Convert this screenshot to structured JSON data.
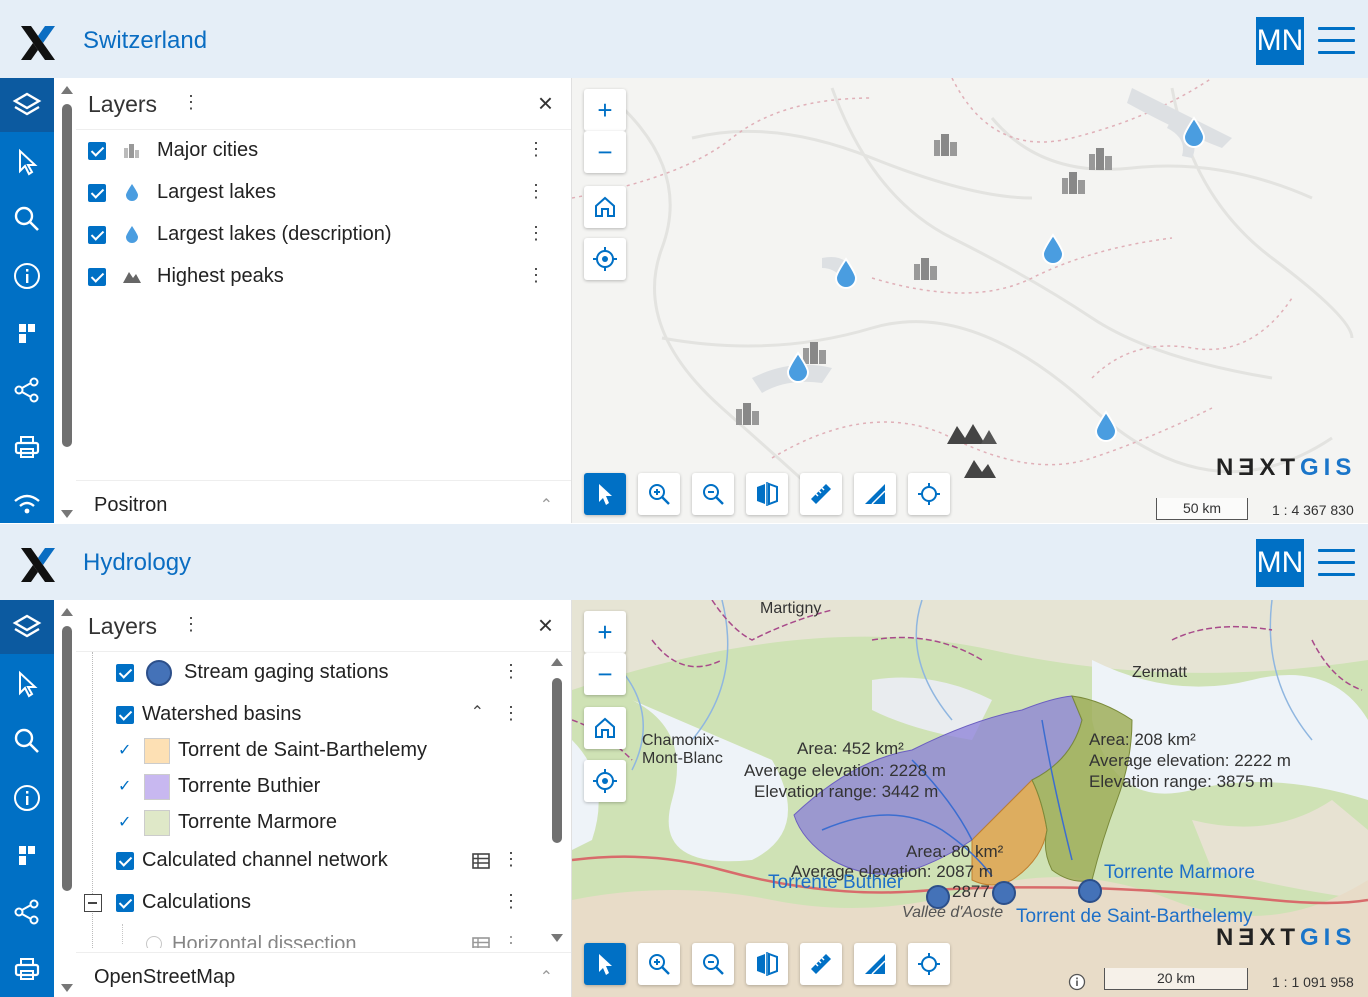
{
  "colors": {
    "primary": "#0070c5",
    "header_bg": "#e5eef7",
    "title": "#0a6dc2"
  },
  "top_panel": {
    "title": "Switzerland",
    "user_initials": "MN",
    "layers": {
      "heading": "Layers",
      "items": [
        {
          "label": "Major cities",
          "icon": "city-icon",
          "checked": true
        },
        {
          "label": "Largest lakes",
          "icon": "water-drop-icon",
          "checked": true
        },
        {
          "label": "Largest lakes (description)",
          "icon": "water-drop-icon",
          "checked": true
        },
        {
          "label": "Highest peaks",
          "icon": "mountain-icon",
          "checked": true
        }
      ],
      "basemap": "Positron"
    },
    "map": {
      "scale_label": "50 km",
      "scale_ratio": "1 : 4 367 830",
      "brand_a": "NƎXT",
      "brand_b": "GIS"
    }
  },
  "bottom_panel": {
    "title": "Hydrology",
    "user_initials": "MN",
    "layers": {
      "heading": "Layers",
      "items": [
        {
          "label": "Stream gaging stations"
        },
        {
          "label": "Watershed basins"
        },
        {
          "label": "Torrent de Saint-Barthelemy",
          "color": "#fde0b4"
        },
        {
          "label": "Torrente Buthier",
          "color": "#c8b8f0"
        },
        {
          "label": "Torrente Marmore",
          "color": "#dfe8c8"
        },
        {
          "label": "Calculated channel network"
        },
        {
          "label": "Calculations"
        },
        {
          "label": "Horizontal dissection"
        }
      ],
      "basemap": "OpenStreetMap"
    },
    "map": {
      "places": [
        "Martigny",
        "Zermatt",
        "Chamonix-",
        "Mont-Blanc",
        "Vallée d'Aoste"
      ],
      "basin_a": [
        "Area: 452 km²",
        "Average elevation: 2228 m",
        "Elevation range: 3442 m"
      ],
      "basin_b": [
        "Area: 208 km²",
        "Average elevation: 2222 m",
        "Elevation range: 3875 m"
      ],
      "basin_c": [
        "Area: 80 km²",
        "Average elevation: 2087 m",
        "2877"
      ],
      "station_labels": [
        "Torrente Buthier",
        "Torrente Marmore",
        "Torrent de Saint-Barthelemy"
      ],
      "scale_label": "20 km",
      "scale_ratio": "1 : 1 091 958",
      "brand_a": "NƎXT",
      "brand_b": "GIS"
    }
  }
}
